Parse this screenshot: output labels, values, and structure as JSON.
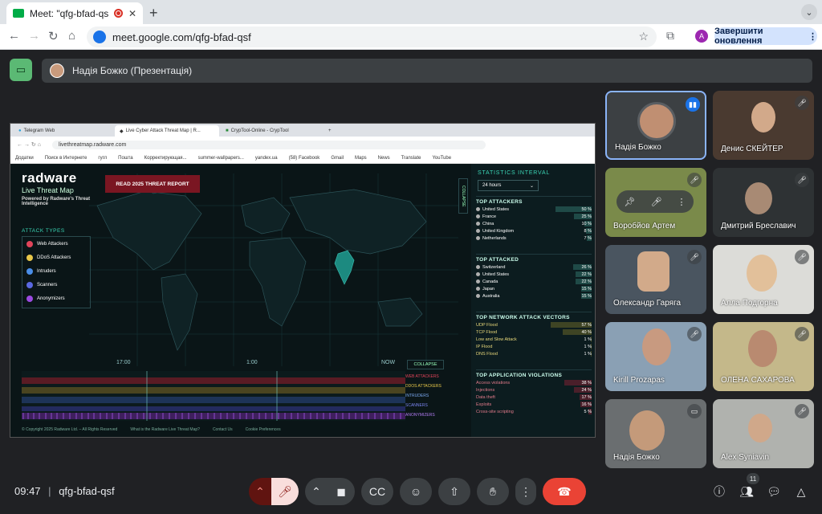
{
  "browser": {
    "tab_title": "Meet: \"qfg-bfad-qsf\"",
    "url": "meet.google.com/qfg-bfad-qsf",
    "profile_initial": "A",
    "update_button": "Завершити оновлення"
  },
  "meet": {
    "presenter_label": "Надія Божко (Презентація)",
    "time": "09:47",
    "meeting_code": "qfg-bfad-qsf",
    "participant_count": "11",
    "participants": [
      {
        "name": "Надія Божко"
      },
      {
        "name": "Денис СКЕЙТЕР"
      },
      {
        "name": "Воробйов Артем"
      },
      {
        "name": "Дмитрий Бреславич"
      },
      {
        "name": "Олександр Гаряга"
      },
      {
        "name": "Алла Подгорна"
      },
      {
        "name": "Kirill Prozapas"
      },
      {
        "name": "ОЛЕНА САХАРОВА"
      },
      {
        "name": "Надія Божко"
      },
      {
        "name": "Alex Syniavin"
      }
    ]
  },
  "shared": {
    "tabs": [
      "Telegram Web",
      "Live Cyber Attack Threat Map | R...",
      "CrypTool-Online - CrypTool"
    ],
    "url": "livethreatmap.radware.com",
    "bookmarks": [
      "Додатки",
      "Поиск в Интернете",
      "гугл",
      "Пошта",
      "Корректирующая...",
      "summer-wallpapers...",
      "yandex.ua",
      "(58) Facebook",
      "Gmail",
      "Maps",
      "News",
      "Translate",
      "YouTube"
    ],
    "logo": "radware",
    "logo_sub": "Live Threat Map",
    "logo_tiny": "Powered by Radware's Threat Intelligence",
    "report_button": "READ 2025 THREAT REPORT",
    "attack_types_title": "ATTACK TYPES",
    "attack_types": [
      {
        "label": "Web Attackers",
        "color": "#e0445a"
      },
      {
        "label": "DDoS Attackers",
        "color": "#e8c84a"
      },
      {
        "label": "Intruders",
        "color": "#4a8ee8"
      },
      {
        "label": "Scanners",
        "color": "#5a68e0"
      },
      {
        "label": "Anonymizers",
        "color": "#9b4ae0"
      }
    ],
    "collapse_label": "COLLAPSE",
    "timeline_labels": [
      "17:00",
      "1:00",
      "NOW"
    ],
    "timeline_legend": [
      "WEB ATTACKERS",
      "DDOS ATTACKERS",
      "INTRUDERS",
      "SCANNERS",
      "ANONYMIZERS"
    ],
    "footer": [
      "© Copyright 2025 Radware Ltd. – All Rights Reserved",
      "What is the Radware Live Threat Map?",
      "Contact Us",
      "Cookie Preferences"
    ],
    "stats_title": "STATISTICS INTERVAL",
    "interval": "24 hours",
    "sections": [
      {
        "title": "TOP ATTACKERS",
        "rows": [
          {
            "name": "United States",
            "value": "50 %",
            "pct": 50
          },
          {
            "name": "France",
            "value": "25 %",
            "pct": 25
          },
          {
            "name": "China",
            "value": "10 %",
            "pct": 10
          },
          {
            "name": "United Kingdom",
            "value": "8 %",
            "pct": 8
          },
          {
            "name": "Netherlands",
            "value": "7 %",
            "pct": 7
          }
        ]
      },
      {
        "title": "TOP ATTACKED",
        "rows": [
          {
            "name": "Switzerland",
            "value": "26 %",
            "pct": 26
          },
          {
            "name": "United States",
            "value": "22 %",
            "pct": 22
          },
          {
            "name": "Canada",
            "value": "22 %",
            "pct": 22
          },
          {
            "name": "Japan",
            "value": "15 %",
            "pct": 15
          },
          {
            "name": "Australia",
            "value": "15 %",
            "pct": 15
          }
        ]
      },
      {
        "title": "TOP NETWORK ATTACK VECTORS",
        "rows": [
          {
            "name": "UDP Flood",
            "value": "57 %",
            "pct": 57
          },
          {
            "name": "TCP Flood",
            "value": "40 %",
            "pct": 40
          },
          {
            "name": "Low and Slow Attack",
            "value": "1 %",
            "pct": 1
          },
          {
            "name": "IP Flood",
            "value": "1 %",
            "pct": 1
          },
          {
            "name": "DNS Flood",
            "value": "1 %",
            "pct": 1
          }
        ]
      },
      {
        "title": "TOP APPLICATION VIOLATIONS",
        "rows": [
          {
            "name": "Access violations",
            "value": "38 %",
            "pct": 38
          },
          {
            "name": "Injections",
            "value": "24 %",
            "pct": 24
          },
          {
            "name": "Data theft",
            "value": "17 %",
            "pct": 17
          },
          {
            "name": "Exploits",
            "value": "16 %",
            "pct": 16
          },
          {
            "name": "Cross-site scripting",
            "value": "5 %",
            "pct": 5
          }
        ]
      }
    ]
  }
}
